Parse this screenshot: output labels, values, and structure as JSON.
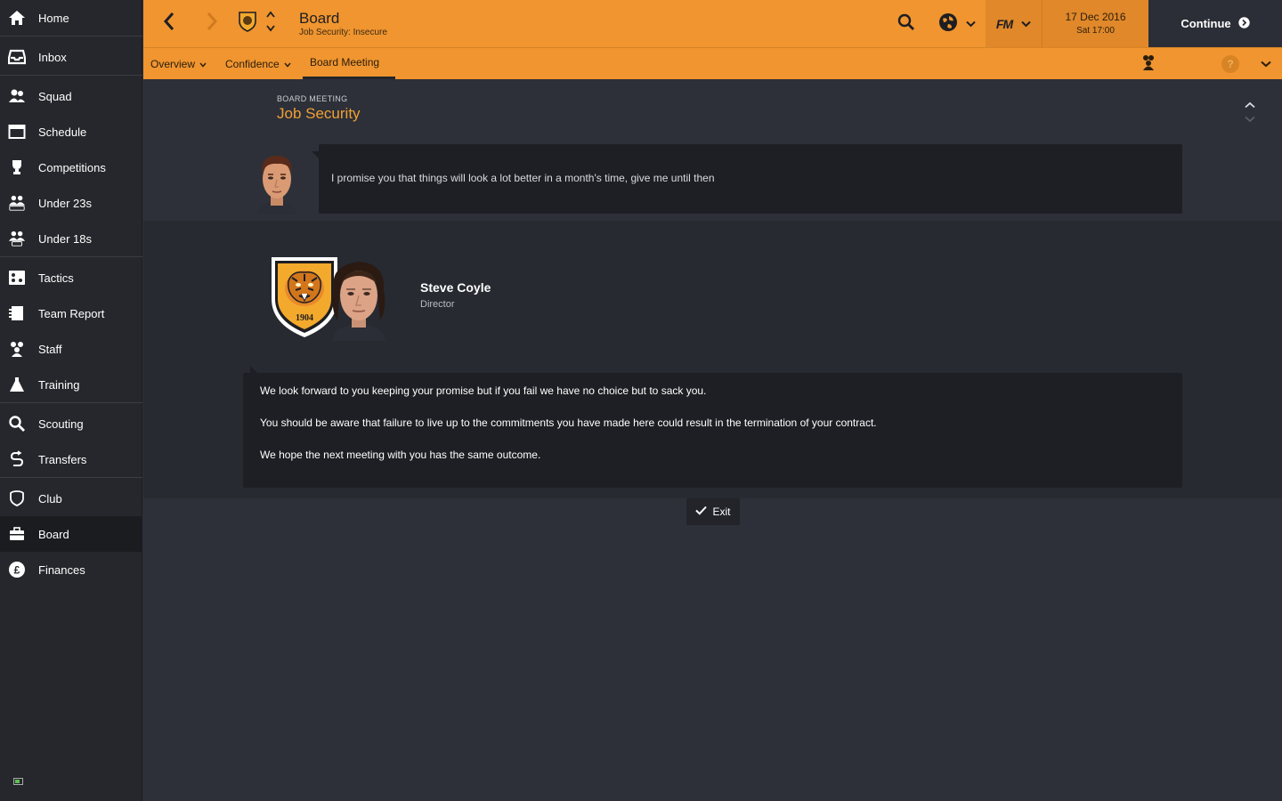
{
  "sidebar": {
    "items": [
      {
        "label": "Home",
        "icon": "home-icon"
      },
      {
        "label": "Inbox",
        "icon": "inbox-icon"
      },
      {
        "label": "Squad",
        "icon": "squad-icon"
      },
      {
        "label": "Schedule",
        "icon": "calendar-icon"
      },
      {
        "label": "Competitions",
        "icon": "trophy-icon"
      },
      {
        "label": "Under 23s",
        "icon": "u23-icon"
      },
      {
        "label": "Under 18s",
        "icon": "u18-icon"
      },
      {
        "label": "Tactics",
        "icon": "tactics-icon"
      },
      {
        "label": "Team Report",
        "icon": "report-icon"
      },
      {
        "label": "Staff",
        "icon": "staff-icon"
      },
      {
        "label": "Training",
        "icon": "training-icon"
      },
      {
        "label": "Scouting",
        "icon": "search-icon"
      },
      {
        "label": "Transfers",
        "icon": "transfers-icon"
      },
      {
        "label": "Club",
        "icon": "club-shield-icon"
      },
      {
        "label": "Board",
        "icon": "briefcase-icon"
      },
      {
        "label": "Finances",
        "icon": "pound-icon"
      }
    ],
    "active": "Board"
  },
  "header": {
    "title": "Board",
    "subtitle": "Job Security: Insecure",
    "logo": "FM",
    "date": "17 Dec 2016",
    "time": "Sat 17:00",
    "continue_label": "Continue",
    "help_label": "?"
  },
  "tabs": [
    {
      "label": "Overview",
      "dropdown": true
    },
    {
      "label": "Confidence",
      "dropdown": true
    },
    {
      "label": "Board Meeting",
      "dropdown": false,
      "active": true
    }
  ],
  "meeting": {
    "section_label": "BOARD MEETING",
    "title": "Job Security",
    "manager_statement": "I promise you that things will look a lot better in a month's time, give me until then",
    "director": {
      "name": "Steve Coyle",
      "role": "Director",
      "crest_year": "1904"
    },
    "responses": [
      "We look forward to you keeping your promise but if you fail we have no choice but to sack you.",
      "You should be aware that failure to live up to the commitments you have made here could result in the termination of your contract.",
      "We hope the next meeting with you has the same outcome."
    ],
    "exit_label": "Exit"
  },
  "colors": {
    "accent": "#f0952f",
    "title_orange": "#f0a035",
    "sidebar_bg": "#25272c",
    "content_bg": "#2d3038",
    "bubble_bg": "#1e1f24"
  }
}
